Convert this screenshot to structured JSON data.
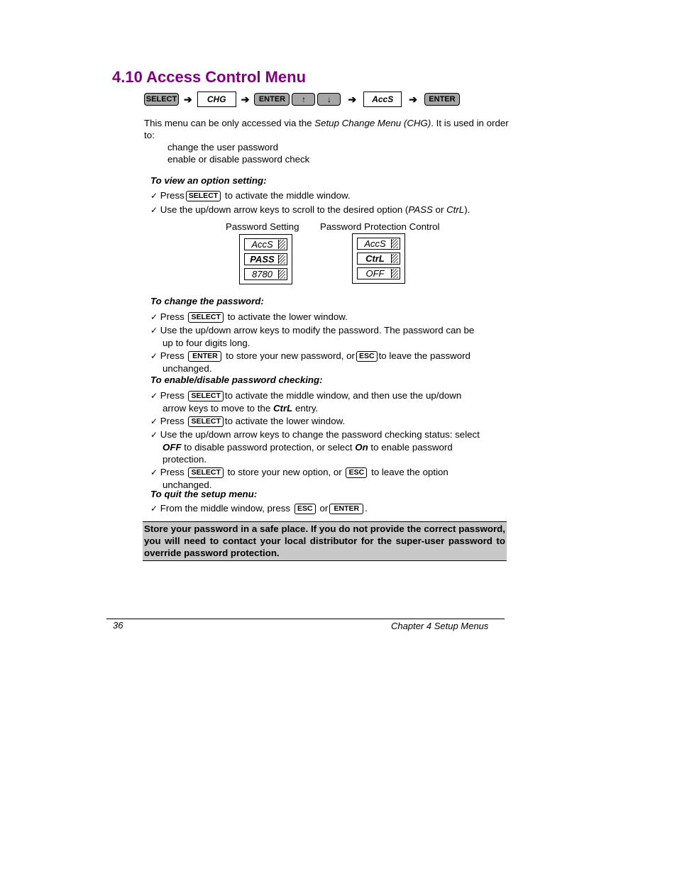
{
  "heading": "4.10  Access Control Menu",
  "key_sequence": [
    {
      "type": "key",
      "label": "SELECT"
    },
    {
      "type": "arrow",
      "label": "➔"
    },
    {
      "type": "display",
      "label": "CHG"
    },
    {
      "type": "arrow",
      "label": "➔"
    },
    {
      "type": "key",
      "label": "ENTER"
    },
    {
      "type": "key",
      "label": "↑"
    },
    {
      "type": "key",
      "label": "↓"
    },
    {
      "type": "arrow",
      "label": "➔"
    },
    {
      "type": "display",
      "label": "AccS"
    },
    {
      "type": "arrow",
      "label": "➔"
    },
    {
      "type": "key",
      "label": "ENTER"
    }
  ],
  "intro": {
    "text_before": "This menu can be only accessed via the ",
    "text_italic": "Setup Change Menu (CHG)",
    "text_after": ". It is used in order to:",
    "items": [
      "change the user password",
      "enable or disable password check"
    ]
  },
  "view": {
    "heading": "To view an option setting:",
    "b1_pre": "Press",
    "b1_key": "SELECT",
    "b1_post": " to activate the middle window.",
    "b2_pre": "Use the up/down arrow keys to scroll to the desired option (",
    "b2_i1": "PASS",
    "b2_mid": " or ",
    "b2_i2": "CtrL",
    "b2_post": ")."
  },
  "displays": [
    {
      "caption": "Password Setting",
      "rows": [
        "AccS",
        "PASS",
        "8780"
      ]
    },
    {
      "caption": "Password Protection Control",
      "rows": [
        "AccS",
        "CtrL",
        "OFF"
      ]
    }
  ],
  "change": {
    "heading": "To change the password:",
    "b1_pre": "Press",
    "b1_key": "SELECT",
    "b1_post": " to activate the lower window.",
    "b2_line1": "Use the up/down arrow keys to modify the password. The password can be",
    "b2_line2": "up to four digits long.",
    "b3_pre": "Press",
    "b3_key1": "ENTER",
    "b3_mid": " to store your new password, or",
    "b3_key2": "ESC",
    "b3_post": "to leave the password",
    "b3_line2": "unchanged."
  },
  "enable": {
    "heading": "To enable/disable password checking:",
    "b1_pre": "Press",
    "b1_key": "SELECT",
    "b1_post": "to activate the middle window, and then use the up/down",
    "b1_line2_pre": "arrow keys to move to the ",
    "b1_line2_b": "CtrL",
    "b1_line2_post": " entry.",
    "b2_pre": "Press",
    "b2_key": "SELECT",
    "b2_post": "to activate the lower window.",
    "b3_line1": "Use the up/down arrow keys to change the password checking status: select",
    "b3_b1": "OFF",
    "b3_mid": " to disable password protection, or select ",
    "b3_b2": "On",
    "b3_post": " to enable password",
    "b3_line3": "protection.",
    "b4_pre": "Press",
    "b4_key1": "SELECT",
    "b4_mid": " to store your new option, or",
    "b4_key2": "ESC",
    "b4_post": " to leave the option",
    "b4_line2": "unchanged."
  },
  "quit": {
    "heading": "To quit the setup menu:",
    "b1_pre": "From the middle window, press",
    "b1_key1": "ESC",
    "b1_mid": "or",
    "b1_key2": "ENTER",
    "b1_post": "."
  },
  "note": "Store your password in a safe place. If you do not provide the correct password, you will need to contact your local distributor for the super-user password to override password protection.",
  "footer": {
    "page": "36",
    "chapter": "Chapter 4  Setup Menus"
  },
  "check_glyph": "✓",
  "colors": {
    "heading": "#800080",
    "key_fill": "#a6a6a6",
    "note_fill": "#c8c8c8"
  }
}
